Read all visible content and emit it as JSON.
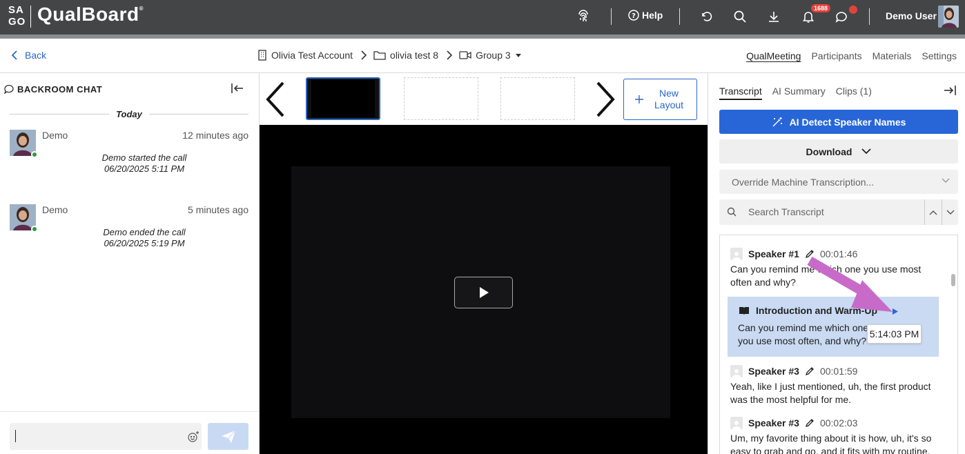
{
  "app": {
    "logo_top": "SA",
    "logo_bottom": "GO",
    "name": "QualBoard",
    "reg": "®",
    "help_label": "Help",
    "notification_count": "1688",
    "user_name": "Demo User"
  },
  "subbar": {
    "back_label": "Back",
    "breadcrumbs": [
      "Olivia Test Account",
      "olivia test 8",
      "Group 3"
    ],
    "nav": [
      "QualMeeting",
      "Participants",
      "Materials",
      "Settings"
    ]
  },
  "chat": {
    "title": "BACKROOM CHAT",
    "day_label": "Today",
    "messages": [
      {
        "name": "Demo",
        "time": "12 minutes ago",
        "line1": "Demo started the call",
        "line2": "06/20/2025 5:11 PM"
      },
      {
        "name": "Demo",
        "time": "5 minutes ago",
        "line1": "Demo ended the call",
        "line2": "06/20/2025 5:19 PM"
      }
    ]
  },
  "layouts": {
    "new_line1": "New",
    "new_line2": "Layout"
  },
  "right": {
    "tabs": [
      "Transcript",
      "AI Summary",
      "Clips (1)"
    ],
    "ai_button": "AI Detect Speaker Names",
    "download_label": "Download",
    "override_label": "Override Machine Transcription...",
    "search_placeholder": "Search Transcript",
    "segments": [
      {
        "speaker": "Speaker #1",
        "time": "00:01:46",
        "text": "Can you remind me which one you use most often and why?"
      },
      {
        "speaker": "Speaker #3",
        "time": "00:01:59",
        "text": "Yeah, like I just mentioned, uh, the first product was the most helpful for me."
      },
      {
        "speaker": "Speaker #3",
        "time": "00:02:03",
        "text": "Um, my favorite thing about it is how, uh, it's so easy to grab and go, and it fits with my routine."
      }
    ],
    "section": {
      "title": "Introduction and Warm-Up",
      "text": "Can you remind me which one you use most often, and why?"
    },
    "tooltip": "5:14:03 PM"
  },
  "colors": {
    "accent": "#2866c6",
    "topbar": "#444547",
    "badge": "#e0433a",
    "annotation_arrow": "#c86bc8",
    "section_highlight": "#c9daf2"
  }
}
